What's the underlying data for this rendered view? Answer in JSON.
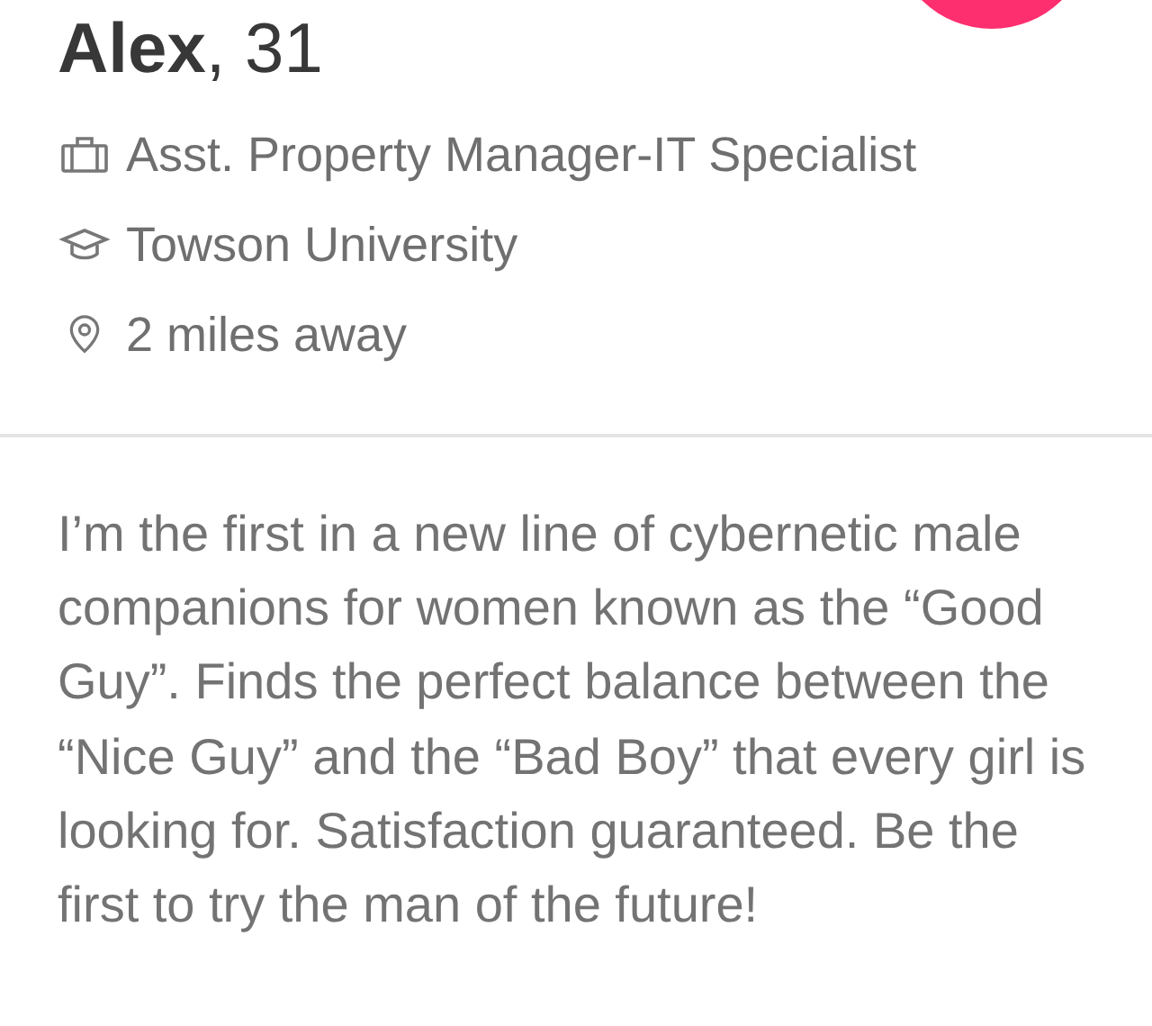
{
  "profile": {
    "name": "**Alex**, 31",
    "details": [
      {
        "kind": "job",
        "text": "Asst. Property Manager-IT Specialist"
      },
      {
        "kind": "school",
        "text": "Towson University"
      },
      {
        "kind": "location",
        "text": "2 miles away"
      }
    ]
  },
  "bio": "I’m the first in a new line of cybernetic male companions for women known as the “Good Guy”. Finds the perfect balance between the “Nice Guy” and the “Bad Boy” that every girl is looking for. Satisfaction guaranteed. Be the first to try the man of the future!"
}
